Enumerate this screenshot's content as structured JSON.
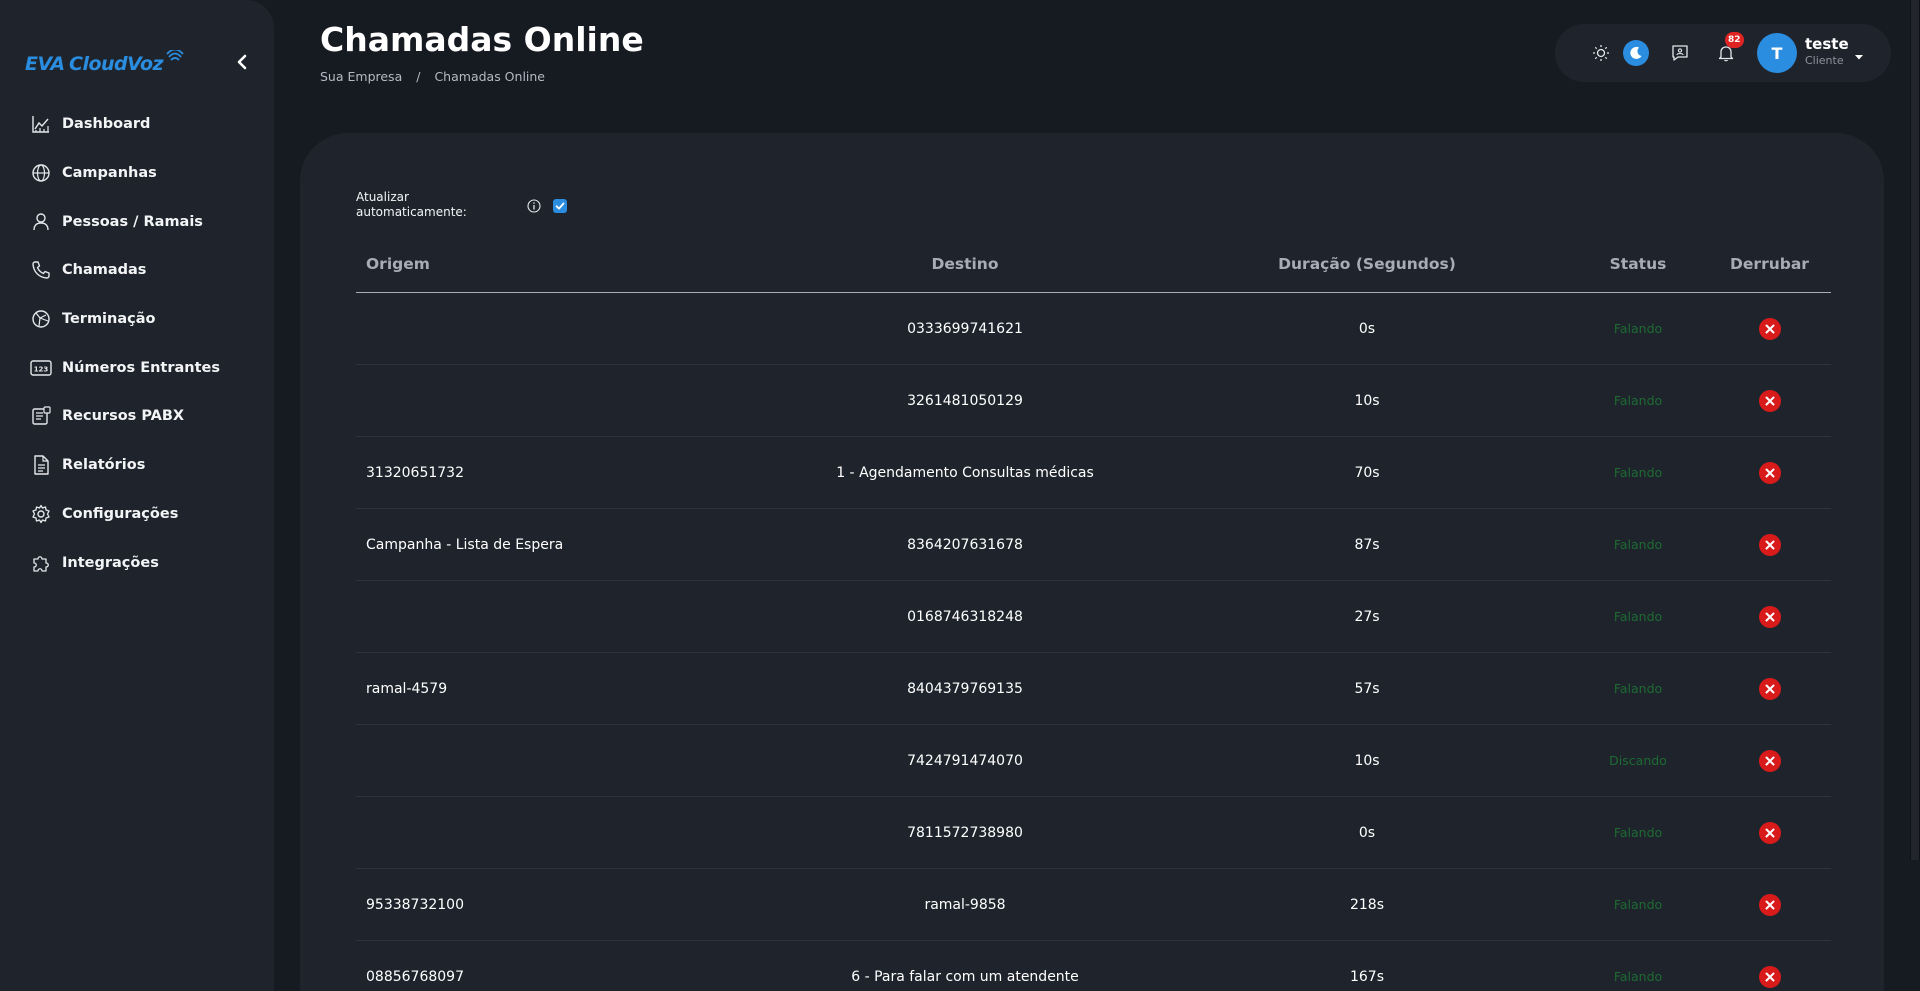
{
  "app": {
    "logo_text": "EVA CloudVoz",
    "accent_color": "#2a8de0"
  },
  "sidebar": {
    "items": [
      {
        "label": "Dashboard",
        "icon": "chart-line-icon"
      },
      {
        "label": "Campanhas",
        "icon": "globe-icon"
      },
      {
        "label": "Pessoas / Ramais",
        "icon": "user-icon"
      },
      {
        "label": "Chamadas",
        "icon": "phone-icon"
      },
      {
        "label": "Terminação",
        "icon": "network-icon"
      },
      {
        "label": "Números Entrantes",
        "icon": "numbers-123-icon"
      },
      {
        "label": "Recursos PABX",
        "icon": "pabx-resources-icon"
      },
      {
        "label": "Relatórios",
        "icon": "report-document-icon"
      },
      {
        "label": "Configurações",
        "icon": "gear-icon"
      },
      {
        "label": "Integrações",
        "icon": "puzzle-icon"
      }
    ]
  },
  "header": {
    "title": "Chamadas Online",
    "breadcrumb": [
      "Sua Empresa",
      "/",
      "Chamadas Online"
    ]
  },
  "topbar": {
    "notification_count": "82",
    "user_initial": "T",
    "user_name": "teste",
    "user_role": "Cliente"
  },
  "controls": {
    "auto_refresh_label": "Atualizar automaticamente:",
    "auto_refresh_checked": true
  },
  "table": {
    "headers": {
      "origem": "Origem",
      "destino": "Destino",
      "duracao": "Duração (Segundos)",
      "status": "Status",
      "derrubar": "Derrubar"
    },
    "status_color": "#1d6b32",
    "drop_color": "#d91a1a",
    "rows": [
      {
        "origem": "",
        "destino": "0333699741621",
        "duracao": "0s",
        "status": "Falando"
      },
      {
        "origem": "",
        "destino": "3261481050129",
        "duracao": "10s",
        "status": "Falando"
      },
      {
        "origem": "31320651732",
        "destino": "1 - Agendamento Consultas médicas",
        "duracao": "70s",
        "status": "Falando"
      },
      {
        "origem": "Campanha - Lista de Espera",
        "destino": "8364207631678",
        "duracao": "87s",
        "status": "Falando"
      },
      {
        "origem": "",
        "destino": "0168746318248",
        "duracao": "27s",
        "status": "Falando"
      },
      {
        "origem": "ramal-4579",
        "destino": "8404379769135",
        "duracao": "57s",
        "status": "Falando"
      },
      {
        "origem": "",
        "destino": "7424791474070",
        "duracao": "10s",
        "status": "Discando"
      },
      {
        "origem": "",
        "destino": "7811572738980",
        "duracao": "0s",
        "status": "Falando"
      },
      {
        "origem": "95338732100",
        "destino": "ramal-9858",
        "duracao": "218s",
        "status": "Falando"
      },
      {
        "origem": "08856768097",
        "destino": "6 - Para falar com um atendente",
        "duracao": "167s",
        "status": "Falando"
      }
    ]
  }
}
